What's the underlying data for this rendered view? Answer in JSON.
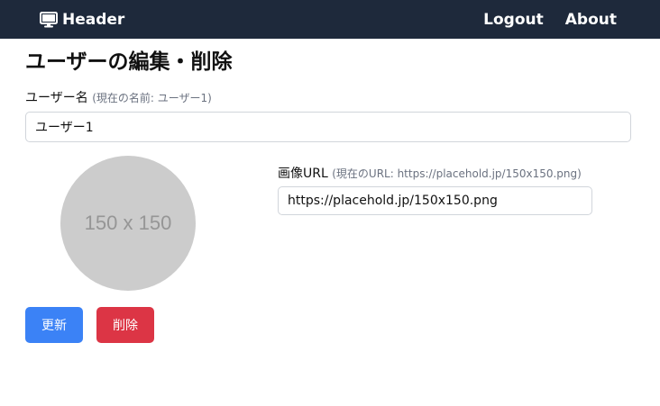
{
  "header": {
    "brand": "Header",
    "brand_icon": "monitor-icon",
    "links": [
      "Logout",
      "About"
    ]
  },
  "page": {
    "title": "ユーザーの編集・削除"
  },
  "username": {
    "label": "ユーザー名",
    "hint": "(現在の名前: ユーザー1)",
    "value": "ユーザー1"
  },
  "avatar": {
    "placeholder_text": "150 x 150"
  },
  "image_url": {
    "label": "画像URL",
    "hint": "(現在のURL: https://placehold.jp/150x150.png)",
    "value": "https://placehold.jp/150x150.png"
  },
  "actions": {
    "update_label": "更新",
    "delete_label": "削除",
    "update_color": "#3b82f6",
    "delete_color": "#dc3545"
  },
  "colors": {
    "navbar": "#1e293b"
  }
}
